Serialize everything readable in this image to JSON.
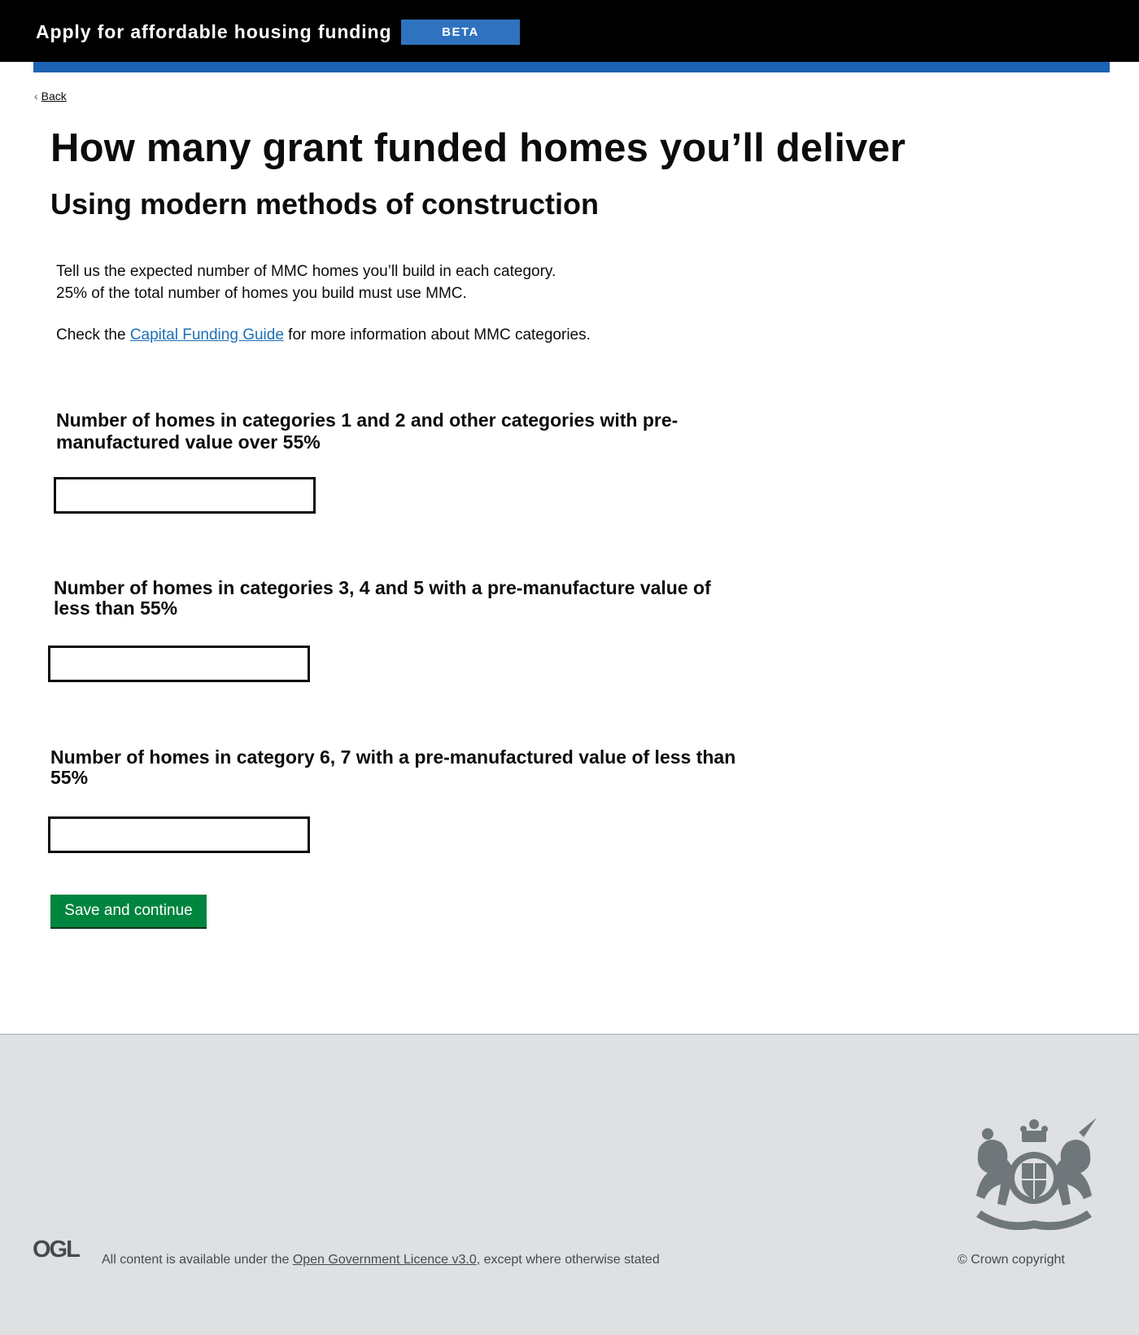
{
  "header": {
    "service_name": "Apply for affordable housing funding",
    "phase_tag": "BETA",
    "colors": {
      "background": "#000000",
      "stripe": "#1d63b4",
      "tag": "#2f73c0"
    }
  },
  "nav": {
    "back_label": "Back",
    "back_icon": "chevron-left-icon"
  },
  "page": {
    "title": "How many grant funded homes you’ll deliver",
    "subtitle": "Using modern methods of construction",
    "intro_line1": "Tell us the expected number of MMC homes you’ll build in each category.",
    "intro_line2": "25% of the total number of homes you build must use MMC.",
    "guide_prefix": "Check the ",
    "guide_link": "Capital Funding Guide",
    "guide_suffix": " for more information about MMC categories."
  },
  "questions": [
    {
      "label": "Number of homes in categories 1 and 2 and other categories with pre-manufactured value over 55%",
      "value": ""
    },
    {
      "label": "Number of homes in categories 3, 4 and 5 with a pre-manufacture value of less than 55%",
      "value": ""
    },
    {
      "label": "Number of homes in category 6, 7 with a pre-manufactured value of less than 55%",
      "value": ""
    }
  ],
  "actions": {
    "save_label": "Save and continue",
    "button_color": "#00853f"
  },
  "footer": {
    "ogl_logo": "OGL",
    "licence_prefix": "All content is available under the ",
    "licence_link": "Open Government Licence v3.0",
    "licence_suffix": ", except where otherwise stated",
    "copyright": "© Crown copyright",
    "crest_icon": "royal-coat-of-arms-icon"
  }
}
